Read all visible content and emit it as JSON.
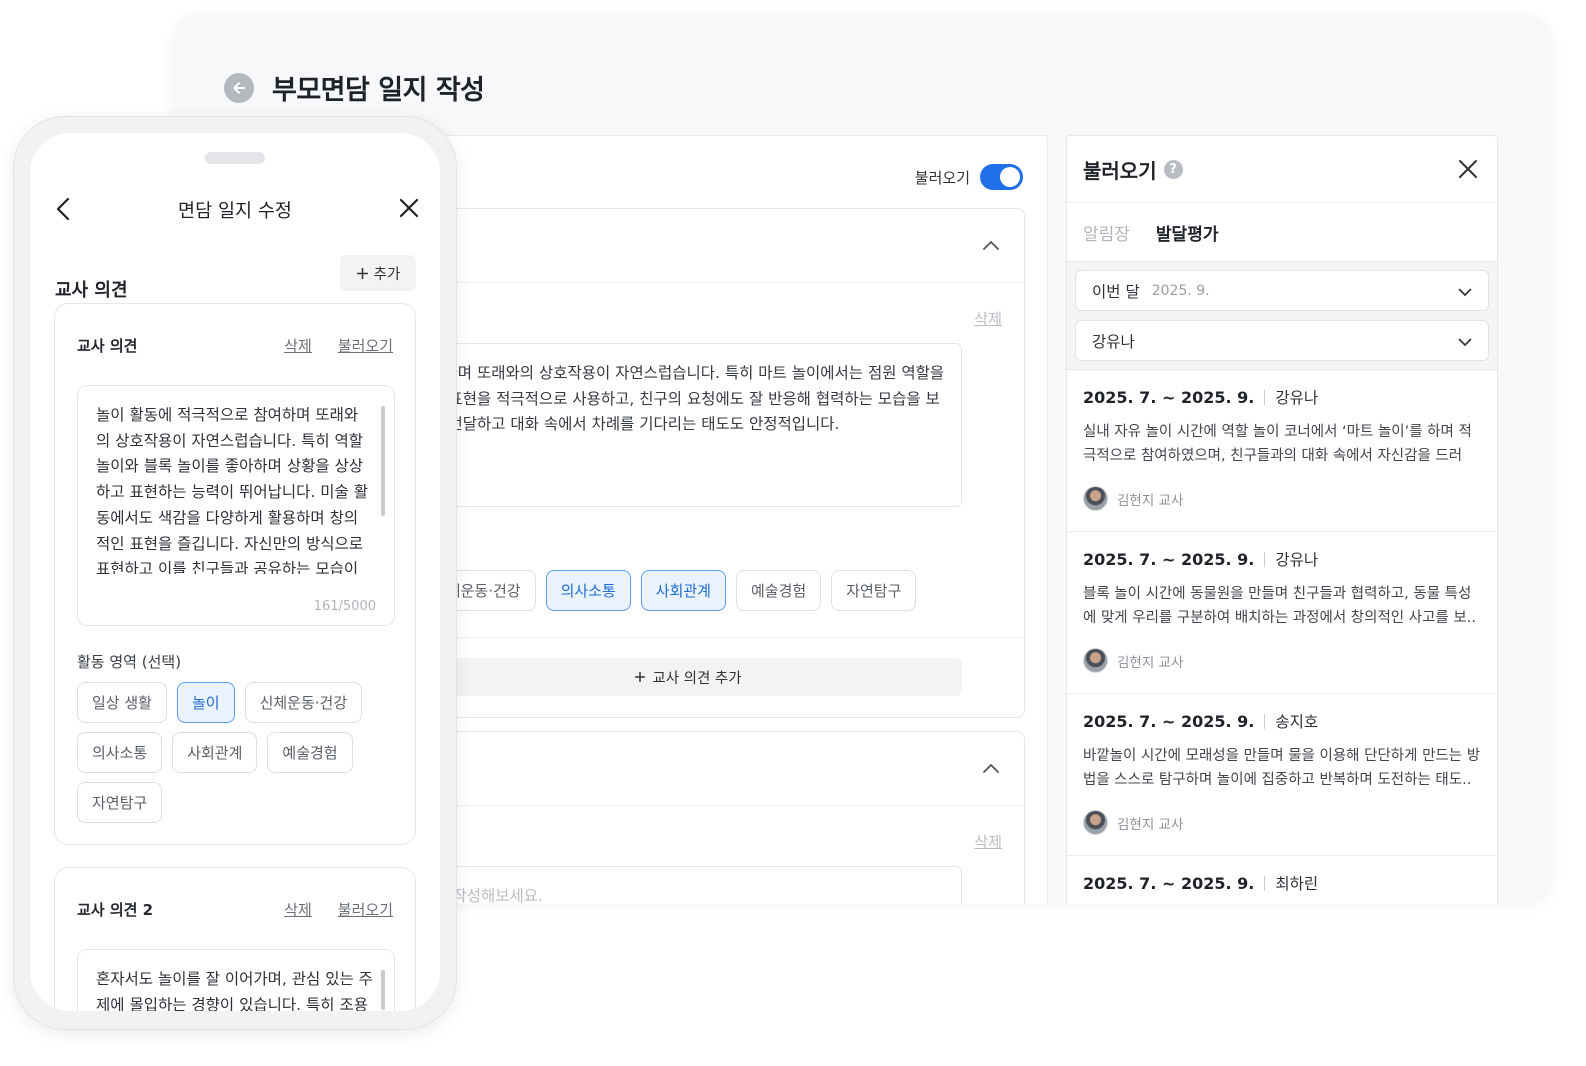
{
  "desktop": {
    "page_title": "부모면담 일지 작성",
    "load_toggle_label": "불러오기",
    "card1": {
      "delete_label": "삭제",
      "text_lines": [
        "참여하며 또래와의 상호작용이 자연스럽습니다. 특히 마트 놀이에서는 점원 역할을",
        "생활 표현을 적극적으로 사용하고, 친구의 요청에도 잘 반응해 협력하는 모습을 보",
        "확히 전달하고 대화 속에서 차례를 기다리는 태도도 안정적입니다."
      ],
      "chips": [
        {
          "label": "신체운동·건강",
          "selected": false
        },
        {
          "label": "의사소통",
          "selected": true
        },
        {
          "label": "사회관계",
          "selected": true
        },
        {
          "label": "예술경험",
          "selected": false
        },
        {
          "label": "자연탐구",
          "selected": false
        }
      ],
      "add_opinion_label": "교사 의견 추가"
    },
    "card2": {
      "delete_label": "삭제",
      "placeholder_fragment": "쉽게 작성해보세요."
    }
  },
  "side_panel": {
    "title": "불러오기",
    "tabs": [
      {
        "label": "알림장",
        "active": false
      },
      {
        "label": "발달평가",
        "active": true
      }
    ],
    "month_filter": {
      "label": "이번 달",
      "value": "2025. 9."
    },
    "child_filter": {
      "value": "강유나"
    },
    "records": [
      {
        "period": "2025. 7. ~ 2025. 9.",
        "child": "강유나",
        "summary": "실내 자유 놀이 시간에 역할 놀이 코너에서 ‘마트 놀이’를 하며 적극적으로 참여하였으며, 친구들과의 대화 속에서 자신감을 드러내..",
        "author": "김현지 교사"
      },
      {
        "period": "2025. 7. ~ 2025. 9.",
        "child": "강유나",
        "summary": "블록 놀이 시간에 동물원을 만들며 친구들과 협력하고, 동물 특성에 맞게 우리를 구분하여 배치하는 과정에서 창의적인 사고를 보..",
        "author": "김현지 교사"
      },
      {
        "period": "2025. 7. ~ 2025. 9.",
        "child": "송지호",
        "summary": "바깥놀이 시간에 모래성을 만들며 물을 이용해 단단하게 만드는 방법을 스스로 탐구하며 놀이에 집중하고 반복하며 도전하는 태도..",
        "author": "김현지 교사"
      },
      {
        "period": "2025. 7. ~ 2025. 9.",
        "child": "최하린",
        "summary": "",
        "author": ""
      }
    ]
  },
  "mobile": {
    "nav_title": "면담 일지 수정",
    "section_title": "교사 의견",
    "add_label": "추가",
    "card1": {
      "label": "교사 의견",
      "delete_label": "삭제",
      "load_label": "불러오기",
      "text": "놀이 활동에 적극적으로 참여하며 또래와\n의 상호작용이 자연스럽습니다. 특히 역할\n놀이와 블록 놀이를 좋아하며 상황을 상상\n하고 표현하는 능력이 뛰어납니다. 미술 활\n동에서도 색감을 다양하게 활용하며 창의\n적인 표현을 즐깁니다. 자신만의 방식으로\n표현하고 이를 친구들과 공유하는 모습이",
      "char_count": "161/5000",
      "area_label": "활동 영역 (선택)",
      "chips": [
        {
          "label": "일상 생활",
          "selected": false
        },
        {
          "label": "놀이",
          "selected": true
        },
        {
          "label": "신체운동·건강",
          "selected": false
        },
        {
          "label": "의사소통",
          "selected": false
        },
        {
          "label": "사회관계",
          "selected": false
        },
        {
          "label": "예술경험",
          "selected": false
        },
        {
          "label": "자연탐구",
          "selected": false
        }
      ]
    },
    "card2": {
      "label": "교사 의견 2",
      "delete_label": "삭제",
      "load_label": "불러오기",
      "text": "혼자서도 놀이를 잘 이어가며, 관심 있는 주\n제에 몰입하는 경향이 있습니다. 특히 조용"
    }
  }
}
